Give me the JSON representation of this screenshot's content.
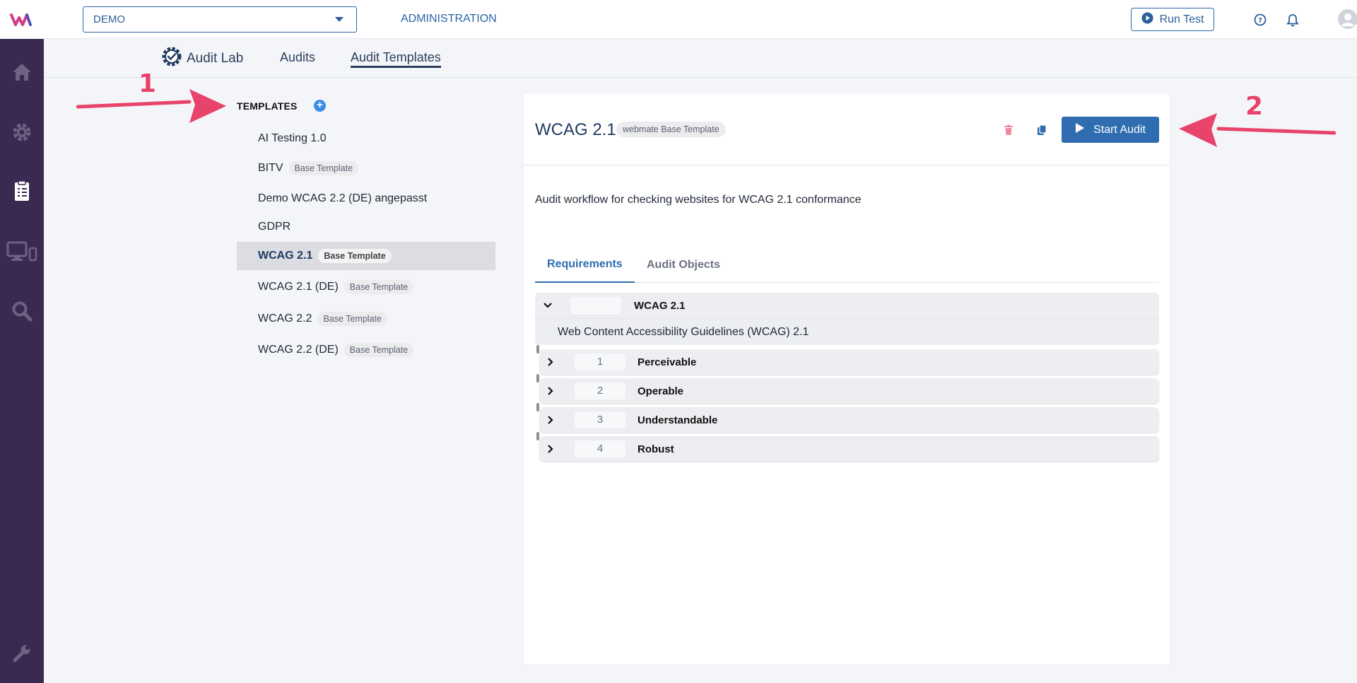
{
  "header": {
    "project": "DEMO",
    "admin_label": "ADMINISTRATION",
    "run_test_label": "Run Test"
  },
  "subnav": {
    "brand": "Audit Lab",
    "items": [
      {
        "label": "Audits"
      },
      {
        "label": "Audit Templates"
      }
    ]
  },
  "annotations": [
    "1",
    "2"
  ],
  "templates": {
    "heading": "TEMPLATES",
    "add_label": "+",
    "items": [
      {
        "name": "AI Testing 1.0",
        "tag": ""
      },
      {
        "name": "BITV",
        "tag": "Base Template"
      },
      {
        "name": "Demo WCAG 2.2 (DE) angepasst",
        "tag": ""
      },
      {
        "name": "GDPR",
        "tag": ""
      },
      {
        "name": "WCAG 2.1",
        "tag": "Base Template"
      },
      {
        "name": "WCAG 2.1 (DE)",
        "tag": "Base Template"
      },
      {
        "name": "WCAG 2.2",
        "tag": "Base Template"
      },
      {
        "name": "WCAG 2.2 (DE)",
        "tag": "Base Template"
      }
    ],
    "selected": "WCAG 2.1"
  },
  "detail": {
    "title": "WCAG 2.1",
    "title_tag": "webmate Base Template",
    "start_audit_label": "Start Audit",
    "description": "Audit workflow for checking websites for WCAG 2.1 conformance",
    "tabs": [
      {
        "label": "Requirements"
      },
      {
        "label": "Audit Objects"
      }
    ],
    "requirements": {
      "root_title": "WCAG 2.1",
      "root_description": "Web Content Accessibility Guidelines (WCAG) 2.1",
      "children": [
        {
          "number": "1",
          "title": "Perceivable"
        },
        {
          "number": "2",
          "title": "Operable"
        },
        {
          "number": "3",
          "title": "Understandable"
        },
        {
          "number": "4",
          "title": "Robust"
        }
      ]
    }
  },
  "colors": {
    "sidebar": "#3a2a52",
    "accent": "#2f6db0",
    "annotation": "#e8436a",
    "delete": "#f08aa0"
  },
  "icons": [
    "logo-icon",
    "home-icon",
    "gear-icon",
    "clipboard-icon",
    "devices-icon",
    "search-icon",
    "wrench-icon",
    "help-icon",
    "bell-icon",
    "avatar-icon",
    "trash-icon",
    "copy-icon",
    "play-icon",
    "chevron-down-icon",
    "chevron-right-icon"
  ]
}
